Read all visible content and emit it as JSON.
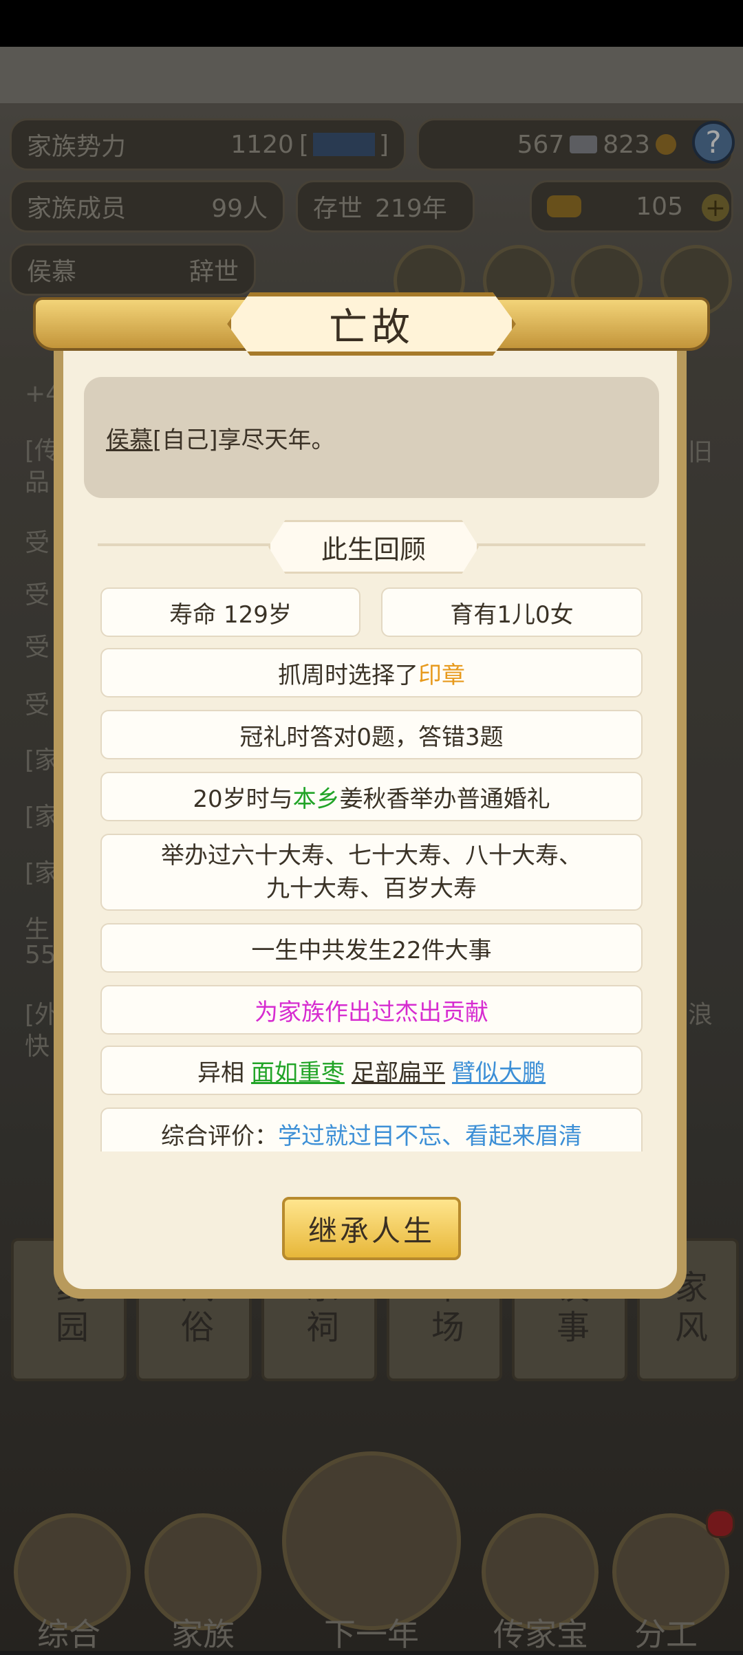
{
  "background": {
    "stats": {
      "family_power_label": "家族势力",
      "family_power_value": "1120",
      "family_power_bracket_left": "[",
      "family_power_bracket_right": "]",
      "currency1": "567",
      "currency2": "823",
      "members_label": "家族成员",
      "members_value": "99人",
      "survival_label": "存世",
      "survival_value": "219年",
      "ingots": "105",
      "person_name": "侯慕",
      "person_status": "辞世"
    },
    "side_fragments_left": [
      "+4",
      "[传",
      "品",
      "受",
      "受",
      "受",
      "受",
      "[家",
      "[家",
      "[家",
      "生",
      "55",
      "[外",
      "快"
    ],
    "side_fragments_right": [
      "旧",
      "浪"
    ],
    "bottom_cards": [
      "药园",
      "风俗",
      "宗祠",
      "市场",
      "议事",
      "家风"
    ],
    "nav": [
      "综合",
      "家族",
      "下一年",
      "传家宝",
      "分工"
    ]
  },
  "dialog": {
    "title": "亡故",
    "message_name": "侯慕",
    "message_rest": "[自己]享尽天年。",
    "section_title": "此生回顾",
    "lifespan": "寿命 129岁",
    "children": "育有1儿0女",
    "zhuazhou_prefix": "抓周时选择了",
    "zhuazhou_item": "印章",
    "guanli": "冠礼时答对0题，答错3题",
    "marriage_prefix": "20岁时与",
    "marriage_place": "本乡",
    "marriage_suffix": "姜秋香举办普通婚礼",
    "birthday_line1": "举办过六十大寿、七十大寿、八十大寿、",
    "birthday_line2": "九十大寿、百岁大寿",
    "events": "一生中共发生22件大事",
    "contribution": "为家族作出过杰出贡献",
    "traits_label": "异相",
    "trait1": "面如重枣",
    "trait2": "足部扁平",
    "trait3": "臂似大鹏",
    "evaluation_label": "综合评价：",
    "evaluation_value": "学过就过目不忘、看起来眉清",
    "button": "继承人生"
  }
}
